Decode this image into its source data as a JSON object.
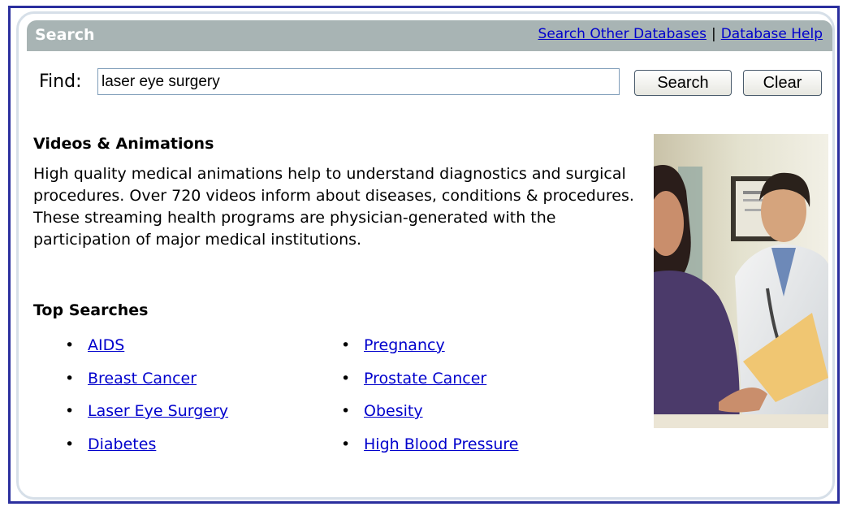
{
  "header": {
    "title": "Search",
    "link_other_databases": "Search Other Databases",
    "separator": "|",
    "link_database_help": "Database Help"
  },
  "search": {
    "find_label": "Find:",
    "value": "laser eye surgery",
    "search_button": "Search",
    "clear_button": "Clear"
  },
  "videos": {
    "heading": "Videos & Animations",
    "description": "High quality medical animations help to understand diagnostics and surgical procedures. Over 720 videos inform about diseases, conditions & procedures. These streaming health programs are physician-generated with the participation of major medical institutions."
  },
  "top_searches": {
    "heading": "Top Searches",
    "bullet": "•",
    "left": [
      "AIDS",
      "Breast Cancer",
      "Laser Eye Surgery",
      "Diabetes"
    ],
    "right": [
      "Pregnancy",
      "Prostate Cancer",
      "Obesity",
      "High Blood Pressure"
    ]
  },
  "colors": {
    "frame": "#2b2f9e",
    "header_bg": "#a8b4b4",
    "link": "#0000cc"
  }
}
